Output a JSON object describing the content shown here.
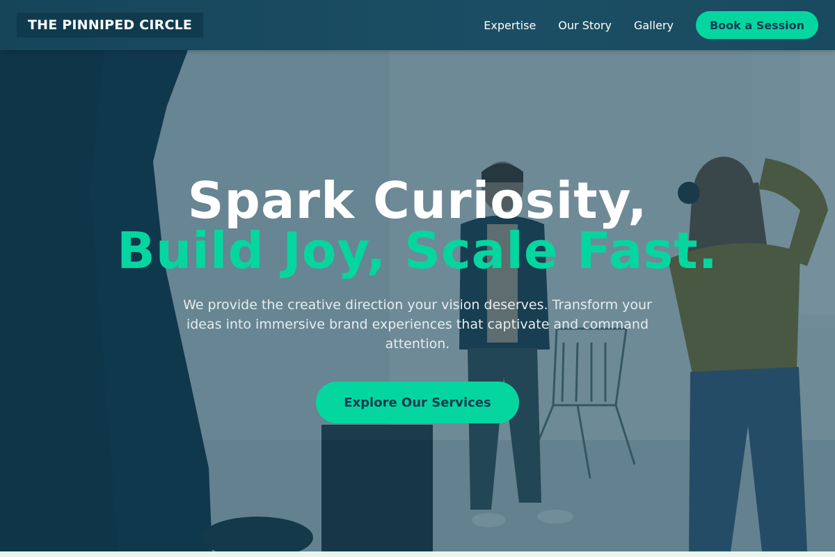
{
  "brand": {
    "name": "THE PINNIPED CIRCLE"
  },
  "nav": {
    "links": [
      "Expertise",
      "Our Story",
      "Gallery"
    ],
    "cta": "Book a Session"
  },
  "hero": {
    "headline_line1": "Spark Curiosity,",
    "headline_line2": "Build Joy, Scale Fast.",
    "subtitle": "We provide the creative direction your vision deserves. Transform your ideas into immersive brand experiences that captivate and command attention.",
    "cta": "Explore Our Services"
  },
  "colors": {
    "accent": "#05d6a0",
    "header_bg": "#1b4e64",
    "logo_bg": "#103b4f",
    "overlay": "#124258"
  }
}
